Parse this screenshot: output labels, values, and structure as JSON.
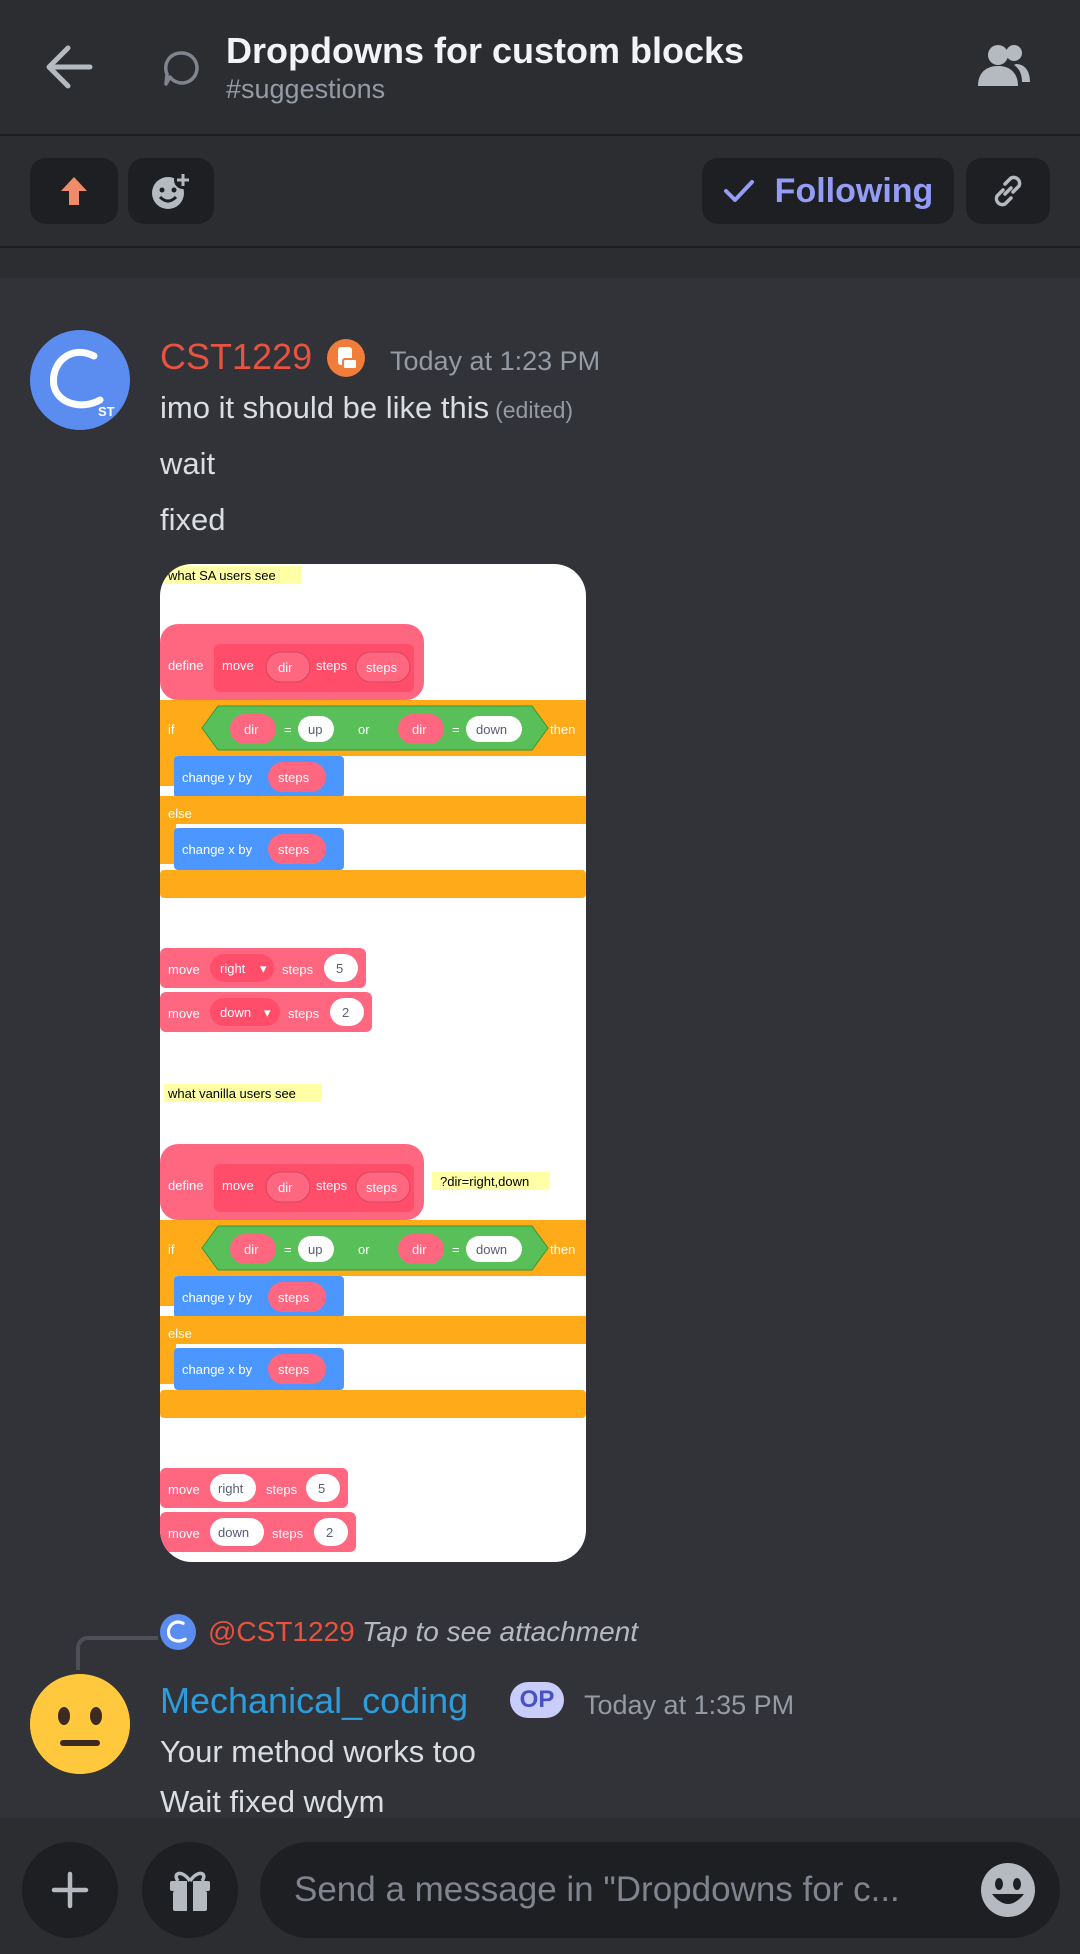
{
  "header": {
    "title": "Dropdowns for custom blocks",
    "channel": "#suggestions"
  },
  "actions": {
    "following_label": "Following"
  },
  "messages": [
    {
      "username": "CST1229",
      "username_color": "#e8523f",
      "timestamp": "Today at 1:23 PM",
      "lines": [
        "imo it should be like this",
        "wait",
        "fixed"
      ],
      "edited_label": "(edited)"
    },
    {
      "reply_user": "@CST1229",
      "reply_text": "Tap to see attachment",
      "username": "Mechanical_coding",
      "username_color": "#2d9cdb",
      "badge": "OP",
      "timestamp": "Today at 1:35 PM",
      "lines": [
        "Your method works too",
        "Wait fixed wdym"
      ]
    }
  ],
  "attachment": {
    "label_sa": "what SA users see",
    "label_vanilla": "what vanilla users see",
    "define": "define",
    "move": "move",
    "dir": "dir",
    "steps": "steps",
    "if": "if",
    "then": "then",
    "or": "or",
    "eq": "=",
    "up": "up",
    "down": "down",
    "right": "right",
    "else": "else",
    "change_y": "change y by",
    "change_x": "change x by",
    "val5": "5",
    "val2": "2",
    "comment": "?dir=right,down",
    "dropdown_arrow": "▾"
  },
  "composer": {
    "placeholder": "Send a message in \"Dropdowns for c..."
  },
  "colors": {
    "background": "#313338",
    "header": "#2b2d31",
    "accent": "#949cf7",
    "block_pink": "#ff6680",
    "block_orange": "#ffab19",
    "block_green": "#59c059",
    "block_blue": "#4c97ff"
  }
}
